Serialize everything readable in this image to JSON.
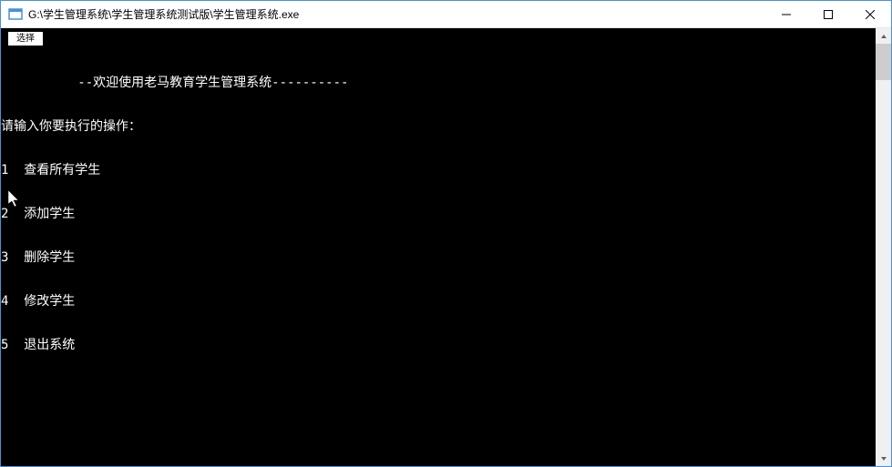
{
  "window": {
    "title": "G:\\学生管理系统\\学生管理系统测试版\\学生管理系统.exe"
  },
  "selection_label": "选择",
  "console": {
    "banner_prefix": "----------",
    "banner_text": "--欢迎使用老马教育学生管理系统----------",
    "prompt": "请输入你要执行的操作：",
    "items": [
      {
        "num": "1",
        "label": "查看所有学生"
      },
      {
        "num": "2",
        "label": "添加学生"
      },
      {
        "num": "3",
        "label": "删除学生"
      },
      {
        "num": "4",
        "label": "修改学生"
      },
      {
        "num": "5",
        "label": "退出系统"
      }
    ]
  }
}
